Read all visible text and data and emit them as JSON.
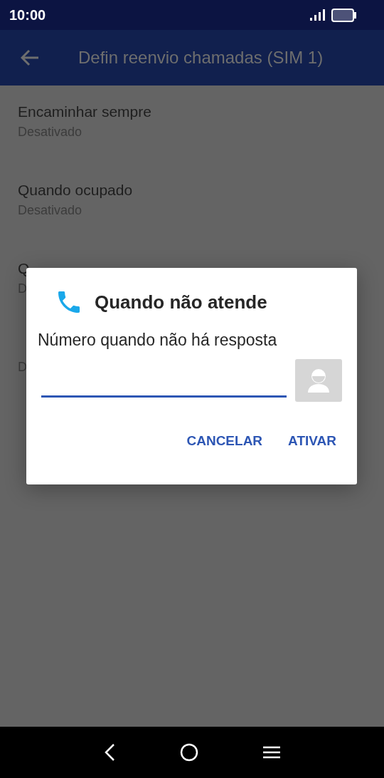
{
  "status_bar": {
    "time": "10:00"
  },
  "app_bar": {
    "title": "Defin reenvio chamadas (SIM 1)"
  },
  "settings": [
    {
      "title": "Encaminhar sempre",
      "summary": "Desativado"
    },
    {
      "title": "Quando ocupado",
      "summary": "Desativado"
    },
    {
      "title": "Q",
      "summary": "D"
    },
    {
      "summary": "D"
    }
  ],
  "dialog": {
    "title": "Quando não atende",
    "message": "Número quando não há resposta",
    "buttons": [
      "CANCELAR",
      "ATIVAR"
    ]
  }
}
